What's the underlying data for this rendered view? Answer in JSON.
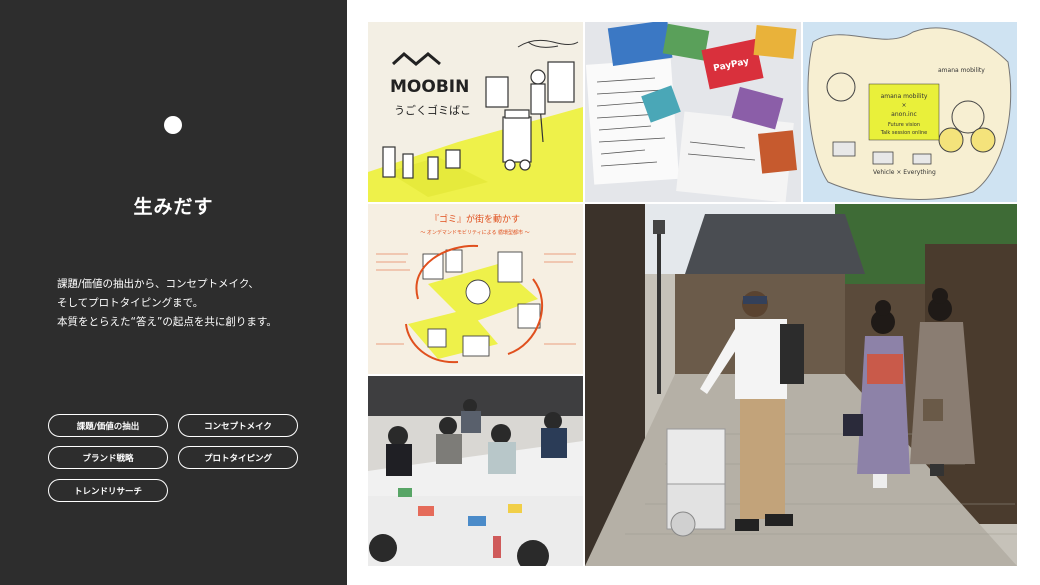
{
  "section": {
    "heading": "生みだす",
    "description": [
      "課題/価値の抽出から、コンセプトメイク、",
      "そしてプロトタイピングまで。",
      "本質をとらえた“答え”の起点を共に創ります。"
    ],
    "tags": [
      "課題/価値の抽出",
      "コンセプトメイク",
      "ブランド戦略",
      "プロトタイピング",
      "トレンドリサーチ"
    ]
  },
  "gallery": {
    "moobin_logo": "MOOBIN",
    "moobin_subtitle": "うごくゴミばこ",
    "poster_title": "『ゴミ』が街を動かす",
    "poster_subtitle": "〜 オンデマンドモビリティによる 循環型都市 〜",
    "talk_lines": [
      "amana mobility",
      "×",
      "anon.inc",
      "Future vision",
      "Talk session online"
    ],
    "map_label_top": "amana mobility",
    "map_label_bottom": "Vehicle × Everything",
    "sticky_paypay": "PayPay"
  }
}
